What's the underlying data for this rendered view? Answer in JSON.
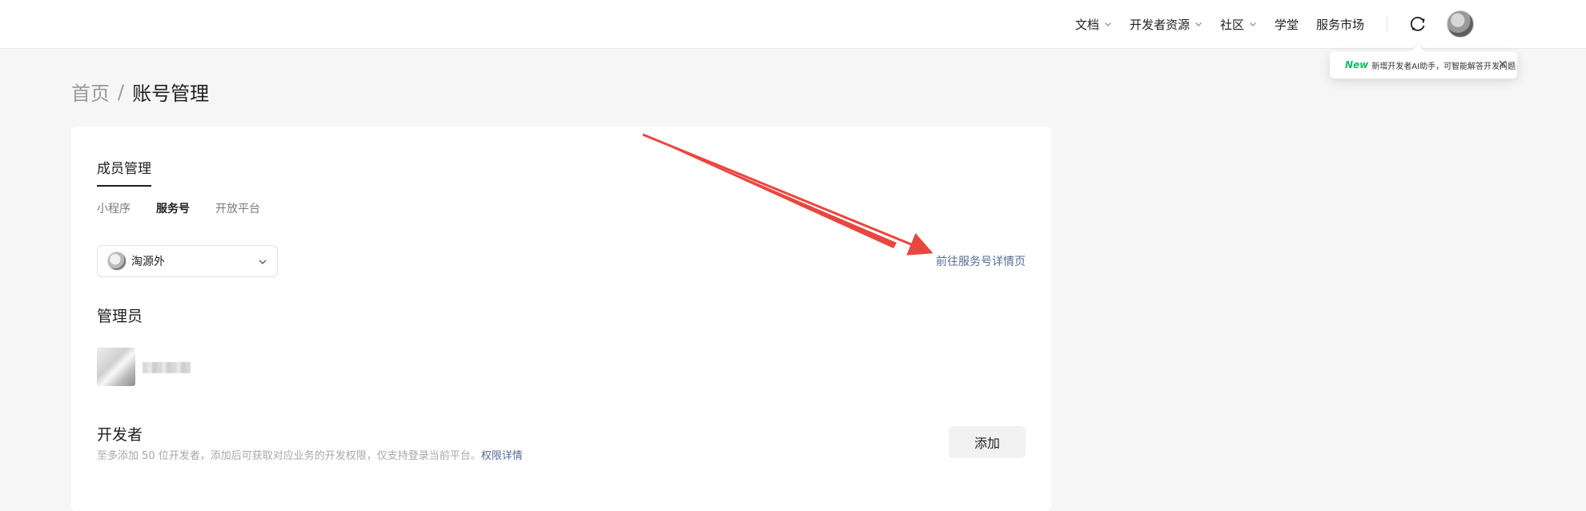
{
  "nav": {
    "items": [
      {
        "label": "文档",
        "dropdown": true
      },
      {
        "label": "开发者资源",
        "dropdown": true
      },
      {
        "label": "社区",
        "dropdown": true
      },
      {
        "label": "学堂",
        "dropdown": false
      },
      {
        "label": "服务市场",
        "dropdown": false
      }
    ],
    "message_icon": "message-refresh-icon",
    "avatar": "user-avatar"
  },
  "popover": {
    "tag": "New",
    "text": "新增开发者AI助手，可智能解答开发问题"
  },
  "breadcrumb": {
    "home": "首页",
    "separator": "/",
    "current": "账号管理"
  },
  "card": {
    "section_tab": "成员管理",
    "subtabs": [
      {
        "label": "小程序",
        "active": false
      },
      {
        "label": "服务号",
        "active": true
      },
      {
        "label": "开放平台",
        "active": false
      }
    ],
    "select": {
      "value": "淘源外"
    },
    "detail_link": "前往服务号详情页",
    "admin_heading": "管理员",
    "developer_heading": "开发者",
    "developer_desc": "至多添加 50 位开发者，添加后可获取对应业务的开发权限，仅支持登录当前平台。",
    "permission_link": "权限详情",
    "add_button": "添加"
  },
  "colors": {
    "link": "#576b95",
    "new_tag": "#07c160",
    "annotation_arrow": "#e8473f"
  }
}
